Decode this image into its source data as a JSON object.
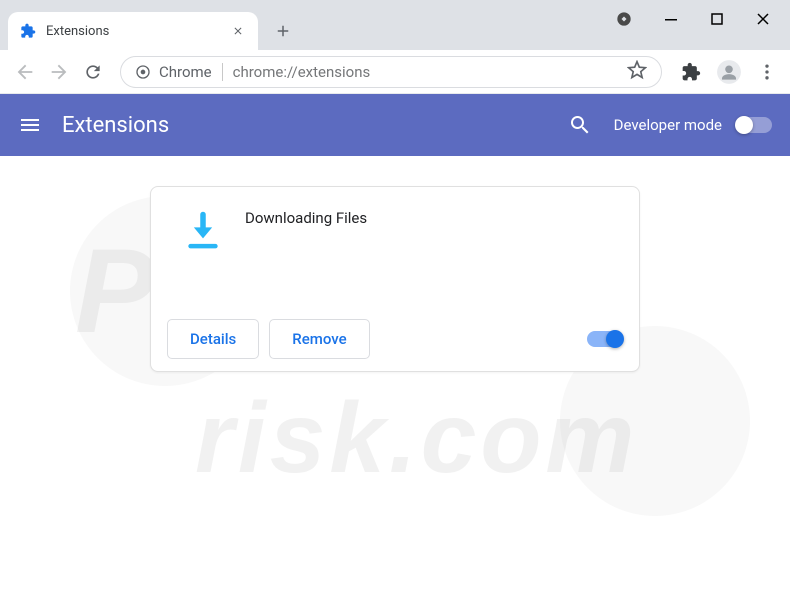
{
  "window": {
    "tab_title": "Extensions",
    "new_tab_tooltip": "New tab"
  },
  "omnibox": {
    "chip_label": "Chrome",
    "url": "chrome://extensions"
  },
  "header": {
    "title": "Extensions",
    "dev_mode_label": "Developer mode",
    "dev_mode_on": false
  },
  "extension": {
    "name": "Downloading Files",
    "details_label": "Details",
    "remove_label": "Remove",
    "enabled": true
  },
  "watermark": {
    "line1": "PC",
    "line2": "risk.com"
  }
}
